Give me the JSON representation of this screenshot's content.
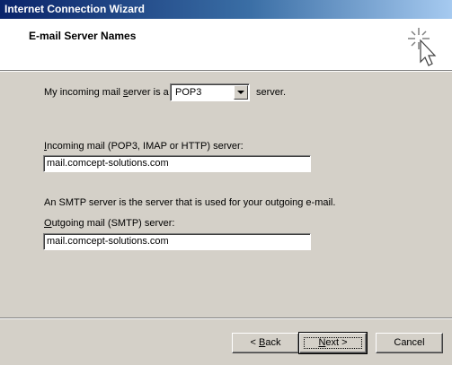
{
  "window": {
    "title": "Internet Connection Wizard"
  },
  "header": {
    "title": "E-mail Server Names",
    "icon": "wizard-wand-icon"
  },
  "form": {
    "incoming_type_prefix": "My incoming mail ",
    "incoming_type_accel": "s",
    "incoming_type_suffix": "erver is a",
    "server_type_value": "POP3",
    "server_type_after": "server.",
    "incoming_label_accel": "I",
    "incoming_label_rest": "ncoming mail (POP3, IMAP or HTTP) server:",
    "incoming_value": "mail.comcept-solutions.com",
    "smtp_info": "An SMTP server is the server that is used for your outgoing e-mail.",
    "outgoing_label_accel": "O",
    "outgoing_label_rest": "utgoing mail (SMTP) server:",
    "outgoing_value": "mail.comcept-solutions.com"
  },
  "buttons": {
    "back_prefix": "< ",
    "back_accel": "B",
    "back_rest": "ack",
    "next_accel": "N",
    "next_rest": "ext >",
    "cancel": "Cancel"
  }
}
